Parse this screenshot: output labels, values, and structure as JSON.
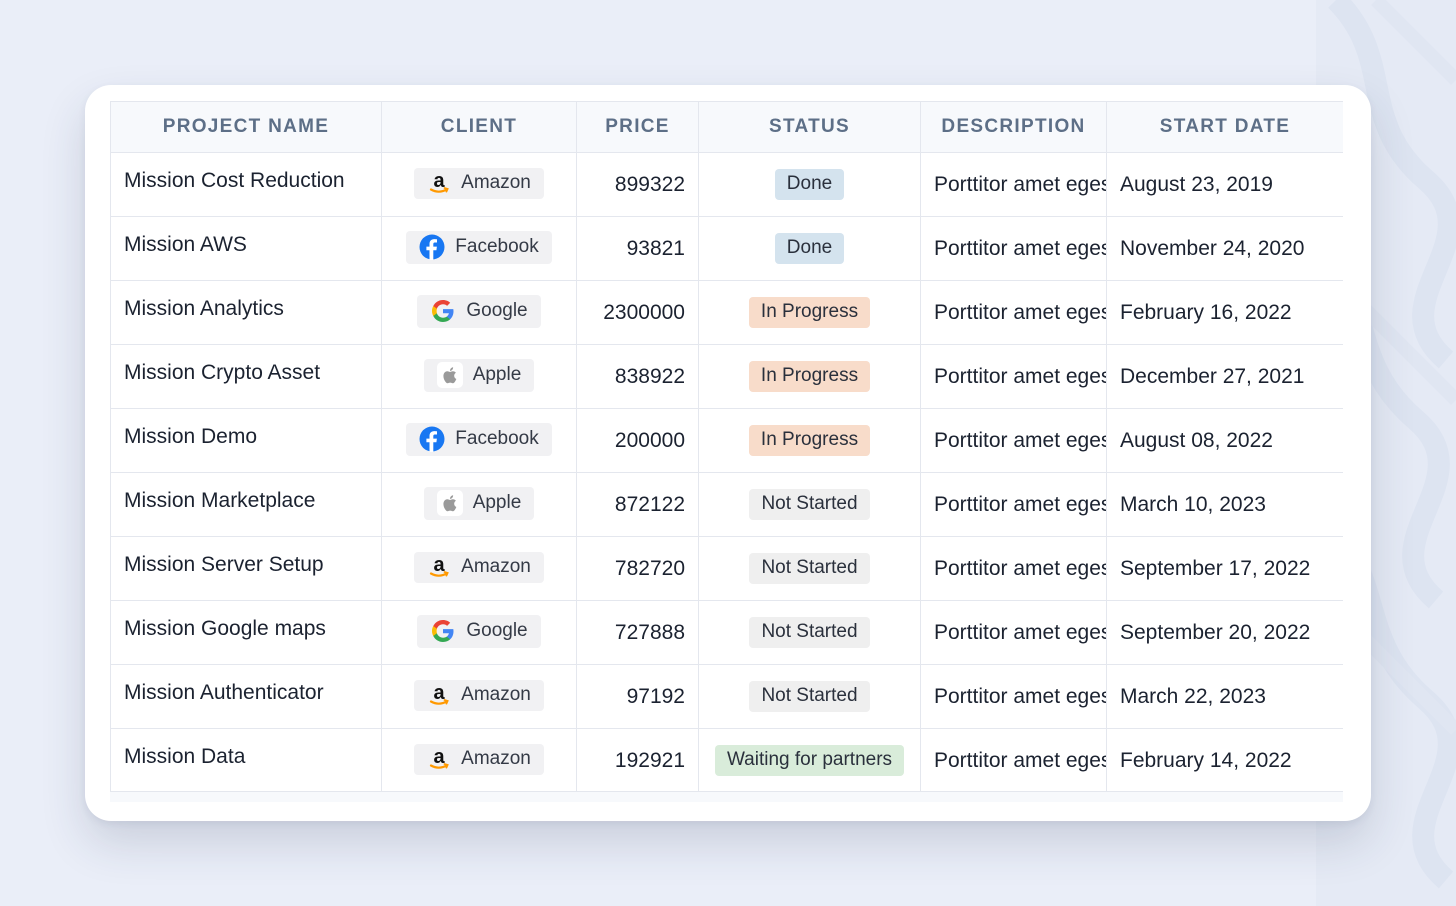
{
  "table": {
    "headers": [
      "PROJECT NAME",
      "CLIENT",
      "PRICE",
      "STATUS",
      "DESCRIPTION",
      "START DATE"
    ],
    "rows": [
      {
        "project": "Mission Cost Reduction",
        "client": "Amazon",
        "client_icon": "amazon-icon",
        "price": "899322",
        "status": "Done",
        "status_kind": "done",
        "description": "Porttitor amet egestas",
        "start_date": "August 23, 2019"
      },
      {
        "project": "Mission AWS",
        "client": "Facebook",
        "client_icon": "facebook-icon",
        "price": "93821",
        "status": "Done",
        "status_kind": "done",
        "description": "Porttitor amet egestas",
        "start_date": "November 24, 2020"
      },
      {
        "project": "Mission Analytics",
        "client": "Google",
        "client_icon": "google-icon",
        "price": "2300000",
        "status": "In Progress",
        "status_kind": "progress",
        "description": "Porttitor amet egestas",
        "start_date": "February 16, 2022"
      },
      {
        "project": "Mission Crypto Asset",
        "client": "Apple",
        "client_icon": "apple-icon",
        "price": "838922",
        "status": "In Progress",
        "status_kind": "progress",
        "description": "Porttitor amet egestas",
        "start_date": "December 27, 2021"
      },
      {
        "project": "Mission Demo",
        "client": "Facebook",
        "client_icon": "facebook-icon",
        "price": "200000",
        "status": "In Progress",
        "status_kind": "progress",
        "description": "Porttitor amet egestas",
        "start_date": "August 08, 2022"
      },
      {
        "project": "Mission Marketplace",
        "client": "Apple",
        "client_icon": "apple-icon",
        "price": "872122",
        "status": "Not Started",
        "status_kind": "notstarted",
        "description": "Porttitor amet egestas",
        "start_date": "March 10, 2023"
      },
      {
        "project": "Mission Server Setup",
        "client": "Amazon",
        "client_icon": "amazon-icon",
        "price": "782720",
        "status": "Not Started",
        "status_kind": "notstarted",
        "description": "Porttitor amet egestas",
        "start_date": "September 17, 2022"
      },
      {
        "project": "Mission Google maps",
        "client": "Google",
        "client_icon": "google-icon",
        "price": "727888",
        "status": "Not Started",
        "status_kind": "notstarted",
        "description": "Porttitor amet egestas",
        "start_date": "September 20, 2022"
      },
      {
        "project": "Mission Authenticator",
        "client": "Amazon",
        "client_icon": "amazon-icon",
        "price": "97192",
        "status": "Not Started",
        "status_kind": "notstarted",
        "description": "Porttitor amet egestas",
        "start_date": "March 22, 2023"
      },
      {
        "project": "Mission Data",
        "client": "Amazon",
        "client_icon": "amazon-icon",
        "price": "192921",
        "status": "Waiting for partners",
        "status_kind": "waiting",
        "description": "Porttitor amet egestas",
        "start_date": "February 14, 2022"
      }
    ]
  },
  "colors": {
    "background": "#eaeef8",
    "header_text": "#5d6f87",
    "status_done": "#d4e3ee",
    "status_in_progress": "#f8dcca",
    "status_not_started": "#efefef",
    "status_waiting": "#d9ecda",
    "facebook_blue": "#1877f2",
    "amazon_orange": "#ff9900"
  }
}
